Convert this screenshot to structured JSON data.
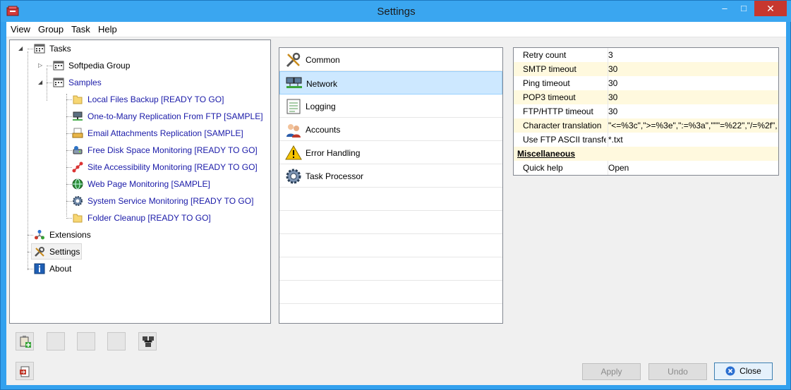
{
  "window": {
    "title": "Settings"
  },
  "menu": [
    "View",
    "Group",
    "Task",
    "Help"
  ],
  "tree": {
    "root": "Tasks",
    "groups": [
      {
        "label": "Softpedia Group"
      },
      {
        "label": "Samples"
      }
    ],
    "samples": [
      {
        "label": "Local Files Backup [READY TO GO]",
        "icon": "folder-icon"
      },
      {
        "label": "One-to-Many Replication From FTP [SAMPLE]",
        "icon": "network-computer-icon"
      },
      {
        "label": "Email Attachments Replication [SAMPLE]",
        "icon": "mail-tray-icon"
      },
      {
        "label": "Free Disk Space Monitoring [READY TO GO]",
        "icon": "disk-monitor-icon"
      },
      {
        "label": "Site Accessibility Monitoring [READY TO GO]",
        "icon": "site-nodes-icon"
      },
      {
        "label": "Web Page Monitoring [SAMPLE]",
        "icon": "globe-icon"
      },
      {
        "label": "System Service Monitoring [READY TO GO]",
        "icon": "gear-icon"
      },
      {
        "label": "Folder Cleanup [READY TO GO]",
        "icon": "folder-icon"
      }
    ],
    "others": [
      {
        "label": "Extensions",
        "icon": "extensions-icon"
      },
      {
        "label": "Settings",
        "icon": "tools-icon"
      },
      {
        "label": "About",
        "icon": "info-icon"
      }
    ]
  },
  "categories": [
    {
      "label": "Common",
      "icon": "tools-icon"
    },
    {
      "label": "Network",
      "icon": "network-icon"
    },
    {
      "label": "Logging",
      "icon": "log-icon"
    },
    {
      "label": "Accounts",
      "icon": "users-icon"
    },
    {
      "label": "Error Handling",
      "icon": "warning-icon"
    },
    {
      "label": "Task Processor",
      "icon": "gear-icon"
    }
  ],
  "properties": [
    {
      "name": "Retry count",
      "value": "3"
    },
    {
      "name": "SMTP timeout",
      "value": "30"
    },
    {
      "name": "Ping timeout",
      "value": "30"
    },
    {
      "name": "POP3 timeout",
      "value": "30"
    },
    {
      "name": "FTP/HTTP timeout",
      "value": "30"
    },
    {
      "name": "Character translation",
      "value": "\"<=%3c\",\">=%3e\",\":=%3a\",\"\"\"=%22\",\"/=%2f\","
    },
    {
      "name": "Use FTP ASCII transfer",
      "value": "*.txt"
    },
    {
      "name": "Miscellaneous",
      "value": ""
    },
    {
      "name": "Quick help",
      "value": "Open"
    }
  ],
  "buttons": {
    "apply": "Apply",
    "undo": "Undo",
    "close": "Close"
  },
  "colors": {
    "titlebar": "#3aa6f0",
    "selection": "#cde8ff",
    "tree_link": "#1a1aa8",
    "close_button": "#c7372e"
  }
}
